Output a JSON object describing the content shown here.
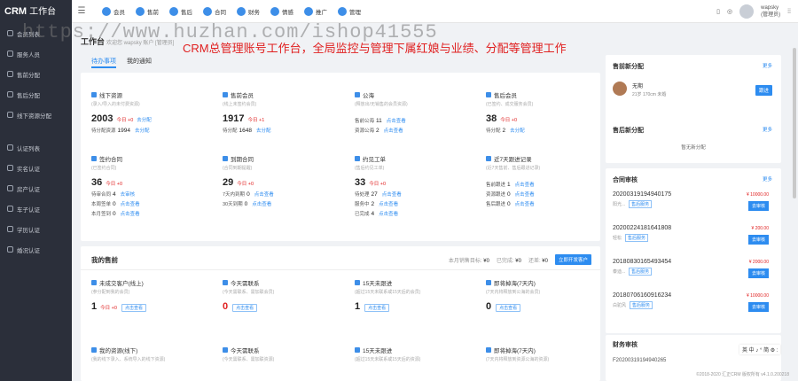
{
  "brand": {
    "name": "CRM",
    "suffix": "工作台"
  },
  "sidebar": {
    "items": [
      "会员列表",
      "服务人员",
      "售前分配",
      "售后分配",
      "线下资源分配"
    ],
    "items2": [
      "认证列表",
      "实名认证",
      "房产认证",
      "车子认证",
      "学历认证",
      "婚况认证"
    ]
  },
  "topnav": [
    "会员",
    "售前",
    "售后",
    "合同",
    "财务",
    "情感",
    "推广",
    "管理"
  ],
  "user": {
    "name": "wapsky",
    "role": "(管理员)"
  },
  "page": {
    "title": "工作台",
    "welcome": "欢迎您 wapsky 账户 [管理员]"
  },
  "overlay_text": "CRM总管理账号工作台，全局监控与管理下属红娘与业绩、分配等管理工作",
  "watermark": "https://www.huzhan.com/ishop41555",
  "tabs": [
    "待办事项",
    "我的通知"
  ],
  "stats": [
    {
      "title": "线下资源",
      "sub": "(录入/导入的未付费资源)",
      "big": "2003",
      "today": "今日 +0",
      "link": "去分配",
      "lines": [
        {
          "k": "待分配资源",
          "v": "1994",
          "a": "去分配"
        }
      ]
    },
    {
      "title": "售前会员",
      "sub": "(线上未签约会员)",
      "big": "1917",
      "today": "今日 +1",
      "link": "",
      "lines": [
        {
          "k": "待分配",
          "v": "1648",
          "a": "去分配"
        }
      ]
    },
    {
      "title": "公海",
      "sub": "(释放出/无销售的会员资源)",
      "big": "",
      "today": "",
      "link": "",
      "lines": [
        {
          "k": "售前公海",
          "v": "11",
          "a": "点击查看"
        },
        {
          "k": "资源公海",
          "v": "2",
          "a": "点击查看"
        }
      ]
    },
    {
      "title": "售后会员",
      "sub": "(已签约、成交服务会员)",
      "big": "38",
      "today": "今日 +0",
      "link": "",
      "lines": [
        {
          "k": "待分配",
          "v": "2",
          "a": "去分配"
        }
      ]
    },
    {
      "title": "签约合同",
      "sub": "(已签约合同)",
      "big": "36",
      "today": "今日 +0",
      "link": "",
      "lines": [
        {
          "k": "待审合同",
          "v": "4",
          "a": "去审核"
        },
        {
          "k": "本周签单",
          "v": "0",
          "a": "点击查看"
        },
        {
          "k": "本月签到",
          "v": "0",
          "a": "点击查看"
        }
      ]
    },
    {
      "title": "到期合同",
      "sub": "(合同到期提醒)",
      "big": "29",
      "today": "今日 +0",
      "link": "",
      "lines": [
        {
          "k": "7天内到期",
          "v": "0",
          "a": "点击查看"
        },
        {
          "k": "30天到期",
          "v": "0",
          "a": "点击查看"
        }
      ]
    },
    {
      "title": "约见工单",
      "sub": "(售后约见工单)",
      "big": "33",
      "today": "今日 +0",
      "link": "",
      "lines": [
        {
          "k": "待处理",
          "v": "27",
          "a": "点击查看"
        },
        {
          "k": "服务中",
          "v": "2",
          "a": "点击查看"
        },
        {
          "k": "已完成",
          "v": "4",
          "a": "点击查看"
        }
      ]
    },
    {
      "title": "近7天跟进记录",
      "sub": "(近7天售前、售后跟进记录)",
      "big": "",
      "today": "",
      "link": "",
      "lines": [
        {
          "k": "售前跟进",
          "v": "1",
          "a": "点击查看"
        },
        {
          "k": "资源跟进",
          "v": "0",
          "a": "点击查看"
        },
        {
          "k": "售后跟进",
          "v": "0",
          "a": "点击查看"
        }
      ]
    }
  ],
  "mysales": {
    "title": "我的售前",
    "target_label": "本月销售目标:",
    "target": "¥0",
    "done_label": "已完成:",
    "done": "¥0",
    "gap_label": "还差:",
    "gap": "¥0",
    "button": "立即开发客户",
    "cards": [
      {
        "title": "未成交客户(线上)",
        "sub": "(参分配到我的会员)",
        "big": "1",
        "today": "今日 +0",
        "btn": "点击查看",
        "red": false
      },
      {
        "title": "今天需联系",
        "sub": "(今天需联系、需加联会员)",
        "big": "0",
        "today": "",
        "btn": "点击查看",
        "red": true
      },
      {
        "title": "15天未跟进",
        "sub": "(超过15天未联系或15天后的会员)",
        "big": "1",
        "today": "",
        "btn": "点击查看",
        "red": false
      },
      {
        "title": "即将掉海(7天内)",
        "sub": "(7天内将释放到公海的会员)",
        "big": "0",
        "today": "",
        "btn": "点击查看",
        "red": false
      }
    ],
    "cards2": [
      {
        "title": "我的资源(线下)",
        "sub": "(我的线下录入、系统导入的线下资源)"
      },
      {
        "title": "今天需联系",
        "sub": "(今天需联系、需加联资源)"
      },
      {
        "title": "15天未跟进",
        "sub": "(超过15天未联系或15天后的资源)"
      },
      {
        "title": "即将掉海(7天内)",
        "sub": "(7天内将释放到资源公海的资源)"
      }
    ]
  },
  "right": {
    "presale": {
      "title": "售前新分配",
      "more": "更多",
      "name": "无期",
      "info": "21岁 170cm 未婚",
      "button": "跟进"
    },
    "aftersale": {
      "title": "售后新分配",
      "more": "更多",
      "empty": "暂无新分配"
    },
    "contracts": {
      "title": "合同审核",
      "more": "更多",
      "items": [
        {
          "no": "20200319194940175",
          "who": "阳光...",
          "tag": "售后服务",
          "amount": "¥ 10000.00",
          "btn": "去审核"
        },
        {
          "no": "20200224181641808",
          "who": "轻松",
          "tag": "售后服务",
          "amount": "¥ 200.00",
          "btn": "去审核"
        },
        {
          "no": "20180830165493454",
          "who": "泰迪...",
          "tag": "售后服务",
          "amount": "¥ 2000.00",
          "btn": "去审核"
        },
        {
          "no": "20180706160916234",
          "who": "白驼风",
          "tag": "售后服务",
          "amount": "¥ 10000.00",
          "btn": "去审核"
        }
      ]
    },
    "finance": {
      "title": "财务审核",
      "partial_no": "F20200319194940265"
    }
  },
  "floatbar": "英 中 ♪ ° 简 ⚙ :",
  "footer": "©2018-2020 汇正CRM 版权所有 v4.1.0.200218"
}
